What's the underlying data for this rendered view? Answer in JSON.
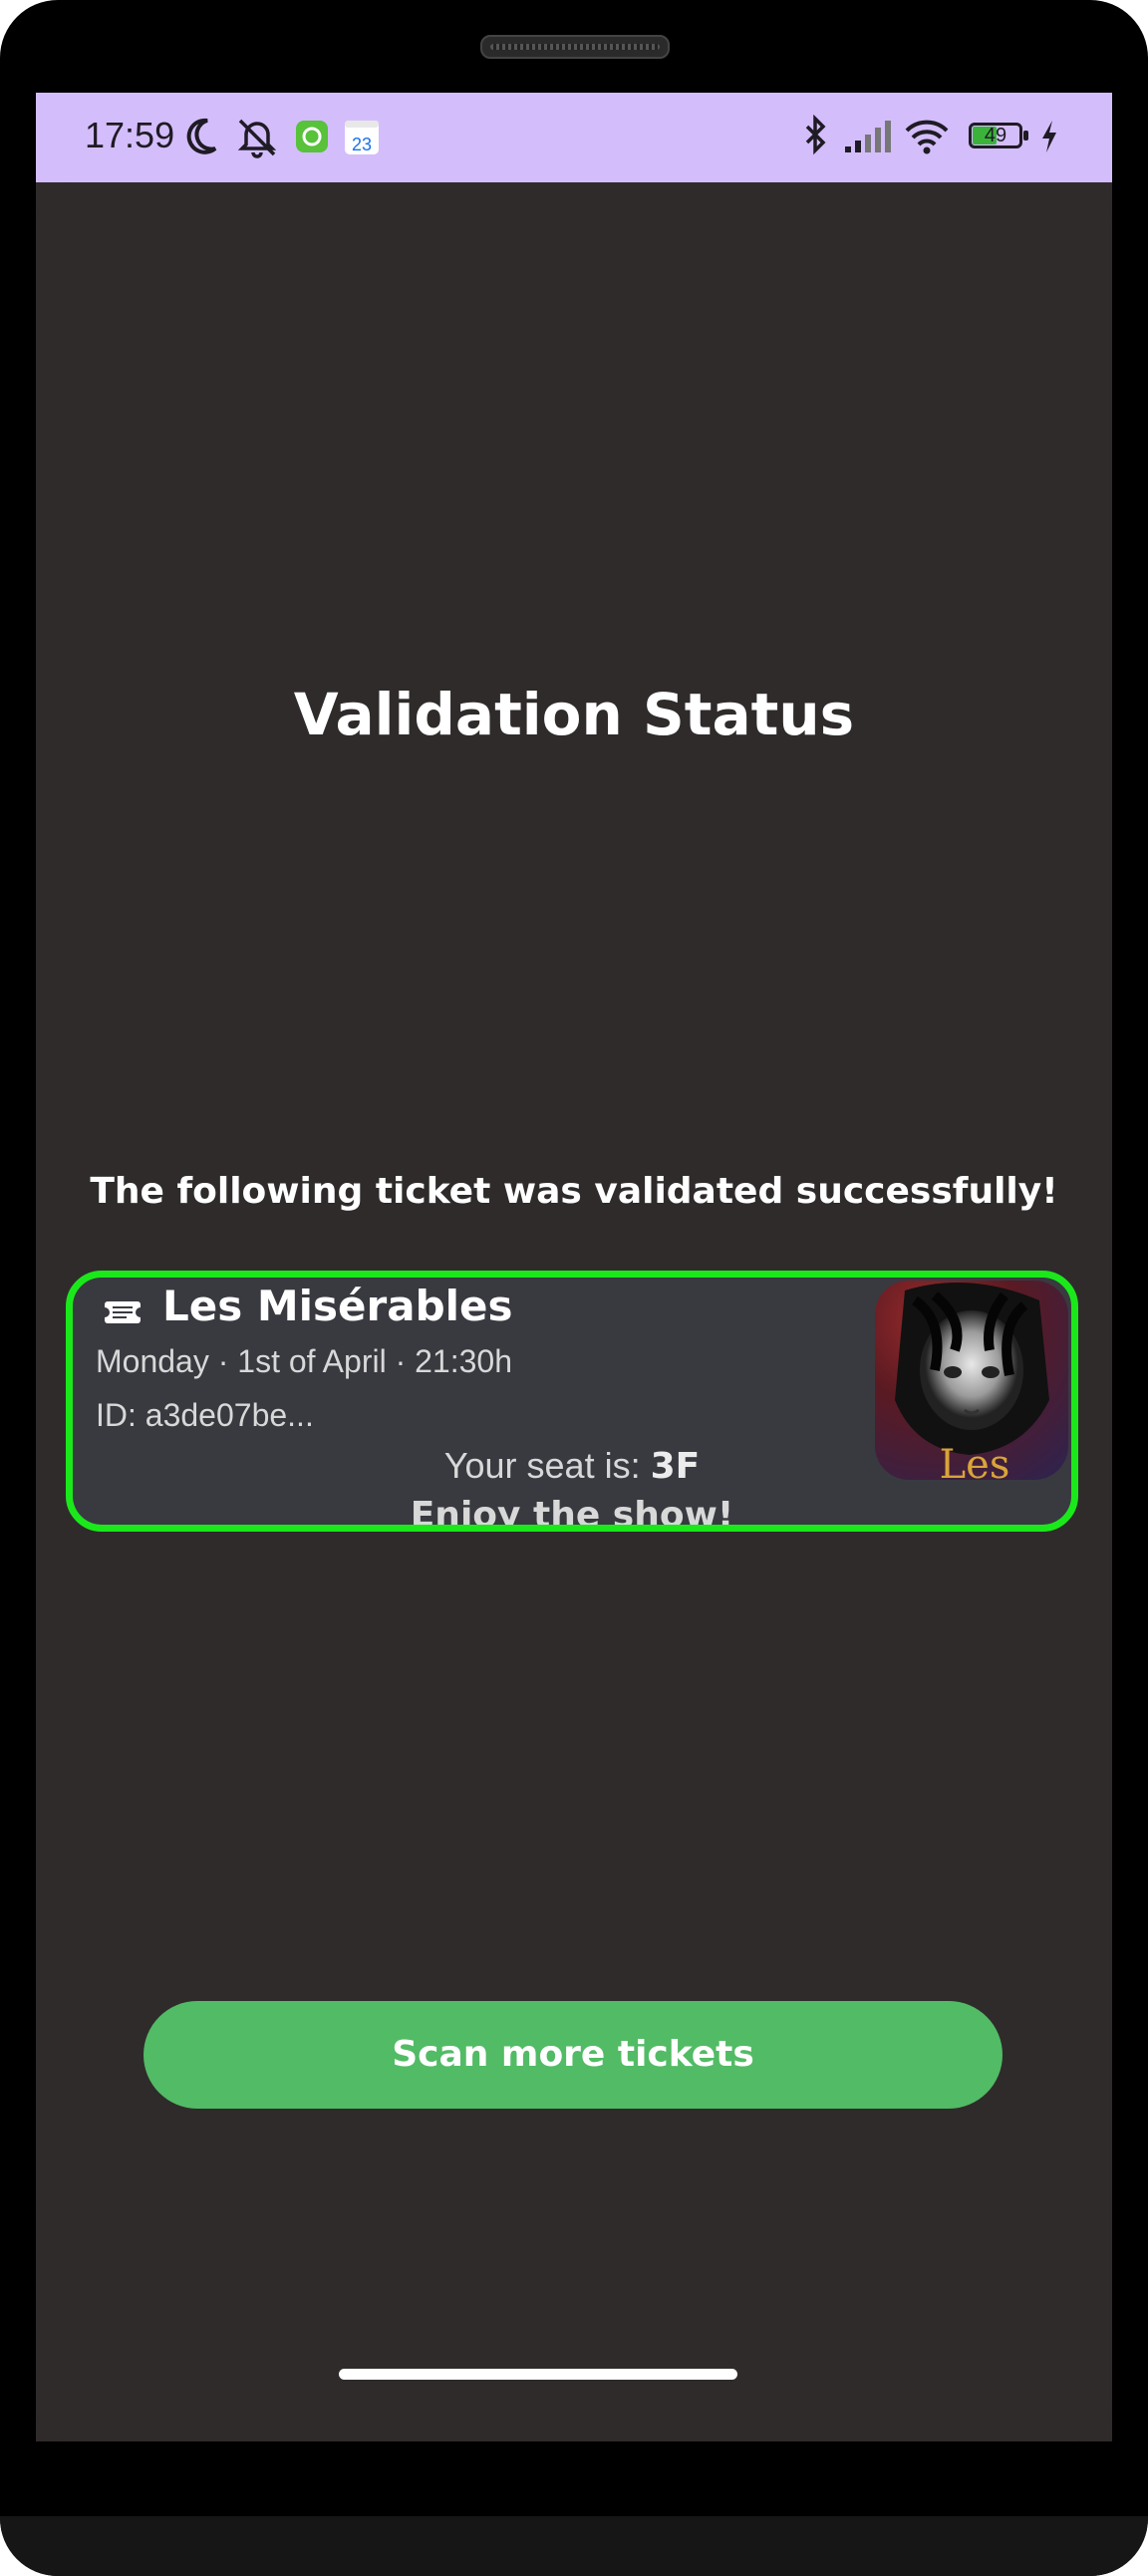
{
  "status_bar": {
    "time": "17:59",
    "battery_level": "49",
    "icons": [
      "moon-icon",
      "notifications-off-icon",
      "app-badge-icon",
      "calendar-icon",
      "bluetooth-icon",
      "signal-icon",
      "wifi-icon",
      "battery-icon",
      "charging-icon"
    ],
    "calendar_day": "23"
  },
  "page": {
    "title": "Validation Status",
    "message": "The following ticket was validated successfully!"
  },
  "ticket": {
    "name": "Les Misérables",
    "date_line": "Monday · 1st of April · 21:30h",
    "id_line": "ID: a3de07be...",
    "seat_prefix": "Your seat is: ",
    "seat": "3F",
    "enjoy": "Enjoy the show!",
    "poster_text": "Les",
    "border_color": "#1be81b"
  },
  "actions": {
    "scan_more_label": "Scan more tickets",
    "button_color": "#52bb65"
  }
}
